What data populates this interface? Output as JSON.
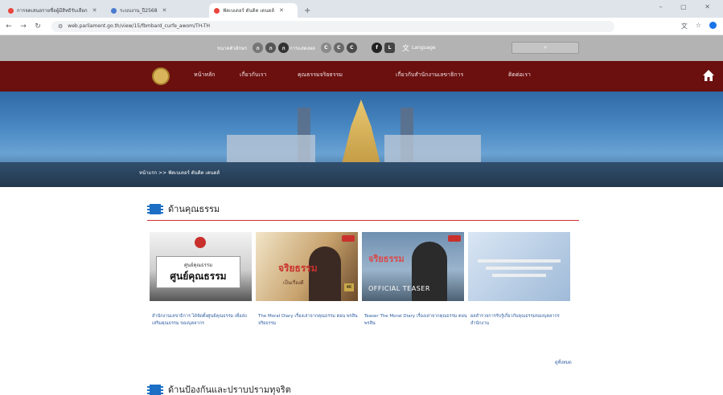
{
  "browser": {
    "tabs": [
      {
        "title": "การจดเสนอรายชื่อผู้มีสิทธิรับเลือก",
        "favicon_color": "#e8453c",
        "active": false
      },
      {
        "title": "ระบบงาน_ปี2568",
        "favicon_color": "#4a7bd0",
        "active": false
      },
      {
        "title": "ฟัดเบเดอร์ ดันติต เดนตส์",
        "favicon_color": "#e8453c",
        "active": true
      }
    ],
    "url": "web.parliament.go.th/view/15/fbmbard_curfe_awom/TH-TH"
  },
  "utility": {
    "font_size_label": "ขนาดตัวอักษร",
    "font_sizes": [
      "ก",
      "ก",
      "ก"
    ],
    "contrast_label": "การแสดงผล",
    "language_label": "Language"
  },
  "nav": {
    "items": [
      "หน้าหลัก",
      "เกี่ยวกับเรา",
      "คุณธรรมจริยธรรม",
      "เกี่ยวกับสำนักงานเลขาธิการ",
      "ติดต่อเรา"
    ]
  },
  "hero": {
    "breadcrumb": "หน้าแรก >> ฟัดเบเดอร์ ดันติต เดนตส์"
  },
  "section1": {
    "title": "ด้านคุณธรรม",
    "cards": [
      {
        "thumb_small": "ศูนย์คุณธรรม",
        "thumb_big": "ศูนย์คุณธรรม",
        "text": "สำนักงานเลขาธิการ ได้จัดตั้งศูนย์คุณธรรม เพื่อส่งเสริมคุณธรรม ของบุคลากร"
      },
      {
        "thumb_title": "จริยธรรม",
        "thumb_sub": "เป็นเรื่องดี",
        "hd_label": "4K",
        "text": "The Moral Diary เรื่องเล่าจากคุณธรรม ตอน พรสิน จริยธรรม"
      },
      {
        "thumb_title": "จริยธรรม",
        "thumb_caption": "OFFICIAL TEASER",
        "text": "Teaser The Moral Diary เรื่องเล่าจากคุณธรรม ตอน พรสิน"
      },
      {
        "text": "ผลสำรวจการรับรู้เกี่ยวกับคุณธรรมของบุคลากรสำนักงาน"
      }
    ],
    "see_all": "ดูทั้งหมด"
  },
  "section2": {
    "title": "ด้านป้องกันและปราบปรามทุจริต"
  },
  "colors": {
    "nav_bg": "#6b0f0f",
    "accent_red": "#c9302c",
    "section_icon": "#1c6fc4",
    "link_blue": "#2c5b9e"
  }
}
